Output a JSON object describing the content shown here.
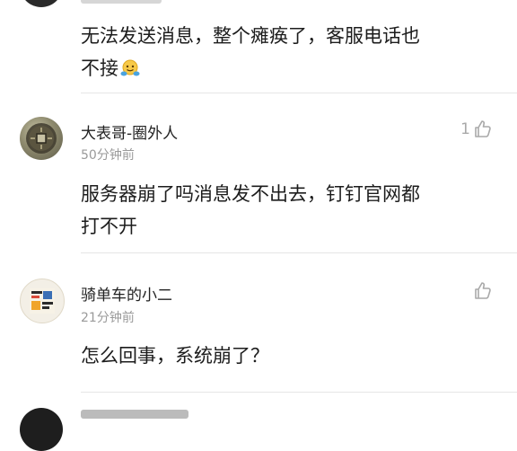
{
  "comments": [
    {
      "name": "",
      "time": "",
      "text_lines": [
        "无法发送消息，整个瘫痪了，客服电话也",
        "不接"
      ],
      "emoji": "face-with-open-hands-icon",
      "likes": ""
    },
    {
      "name": "大表哥-圈外人",
      "time": "50分钟前",
      "text_lines": [
        "服务器崩了吗消息发不出去，钉钉官网都",
        "打不开"
      ],
      "likes": "1"
    },
    {
      "name": "骑单车的小二",
      "time": "21分钟前",
      "text_lines": [
        "怎么回事，系统崩了？"
      ],
      "likes": ""
    }
  ],
  "colors": {
    "divider": "#e6e6e6",
    "muted": "#9a9a9a",
    "text": "#1c1c1c",
    "like": "#a9a9a9"
  }
}
